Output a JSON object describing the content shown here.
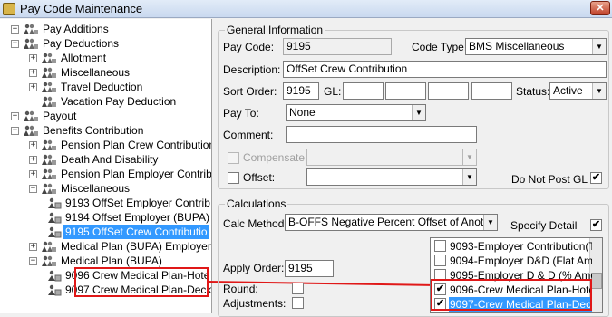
{
  "window": {
    "title": "Pay Code Maintenance",
    "close_glyph": "✕"
  },
  "tree": {
    "nodes": [
      {
        "label": "Pay Additions",
        "expander": "+"
      },
      {
        "label": "Pay Deductions",
        "expander": "−"
      },
      {
        "label": "Allotment",
        "expander": "+"
      },
      {
        "label": "Miscellaneous",
        "expander": "+"
      },
      {
        "label": "Travel Deduction",
        "expander": "+"
      },
      {
        "label": "Vacation Pay Deduction",
        "expander": ""
      },
      {
        "label": "Payout",
        "expander": "+"
      },
      {
        "label": "Benefits Contribution",
        "expander": "−"
      },
      {
        "label": "Pension Plan Crew Contribution",
        "expander": "+"
      },
      {
        "label": "Death And Disability",
        "expander": "+"
      },
      {
        "label": "Pension Plan Employer Contributio",
        "expander": "+"
      },
      {
        "label": "Miscellaneous",
        "expander": "−"
      },
      {
        "label": "9193 OffSet Employer Contrib",
        "expander": ""
      },
      {
        "label": "9194 Offset Employer (BUPA)",
        "expander": ""
      },
      {
        "label": "9195 OffSet Crew Contributio",
        "expander": ""
      },
      {
        "label": "Medical Plan (BUPA) Employer Cor",
        "expander": "+"
      },
      {
        "label": "Medical Plan (BUPA)",
        "expander": "−"
      },
      {
        "label": "9096 Crew Medical Plan-Hote",
        "expander": ""
      },
      {
        "label": "9097 Crew Medical Plan-Deck",
        "expander": ""
      }
    ]
  },
  "general": {
    "title": "General Information",
    "pay_code_label": "Pay Code:",
    "pay_code_value": "9195",
    "code_type_label": "Code Type:",
    "code_type_value": "BMS Miscellaneous",
    "description_label": "Description:",
    "description_value": "OffSet Crew Contribution",
    "sort_order_label": "Sort Order:",
    "sort_order_value": "9195",
    "gl_label": "GL:",
    "status_label": "Status:",
    "status_value": "Active",
    "pay_to_label": "Pay To:",
    "pay_to_value": "None",
    "comment_label": "Comment:",
    "compensate_label": "Compensate:",
    "offset_label": "Offset:",
    "do_not_post_label": "Do Not Post GL",
    "do_not_post_checked": "✔"
  },
  "calc": {
    "title": "Calculations",
    "method_label": "Calc Method:",
    "method_value": "B-OFFS Negative Percent Offset of Another",
    "specify_label": "Specify Detail",
    "specify_checked": "✔",
    "apply_order_label": "Apply Order:",
    "apply_order_value": "9195",
    "round_label": "Round:",
    "adjustments_label": "Adjustments:",
    "list": [
      {
        "text": "9093-Employer Contribution(Tier",
        "check": ""
      },
      {
        "text": "9094-Employer D&D (Flat Amour",
        "check": ""
      },
      {
        "text": "9095-Employer D & D (% Amoun",
        "check": ""
      },
      {
        "text": "9096-Crew Medical Plan-Hotel-Sp",
        "check": "✔"
      },
      {
        "text": "9097-Crew Medical Plan-Deck-Sp",
        "check": "✔"
      }
    ]
  },
  "icons": {
    "folder": "folder-people-icon",
    "item": "paycode-item-icon"
  },
  "colors": {
    "selection": "#3399ff",
    "highlight": "#e01818"
  }
}
